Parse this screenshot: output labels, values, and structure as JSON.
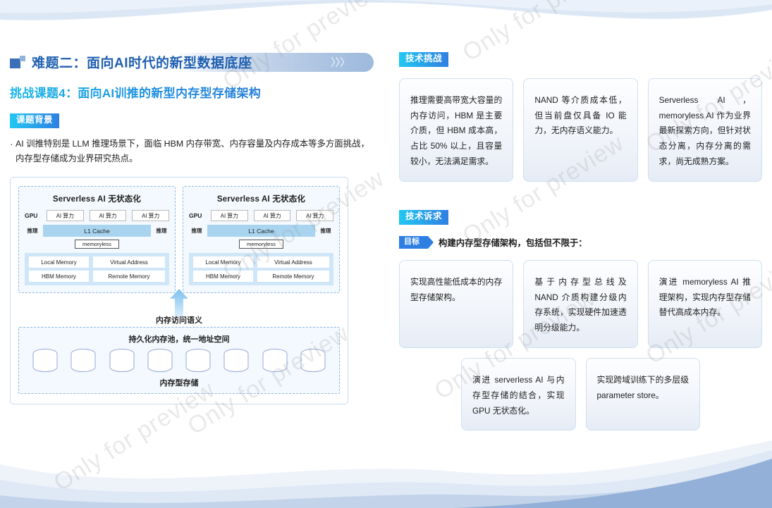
{
  "header": {
    "title": "难题二：面向AI时代的新型数据底座",
    "chevrons": "〉〉〉",
    "icon_big": "square-large",
    "icon_small": "square-small"
  },
  "subtitle": "挑战课题4：面向AI训推的新型内存型存储架构",
  "background": {
    "badge": "课题背景",
    "paragraph": "AI 训推特别是 LLM 推理场景下，面临 HBM 内存带宽、内存容量及内存成本等多方面挑战，内存型存储成为业界研究热点。"
  },
  "diagram": {
    "panels": [
      {
        "title": "Serverless AI 无状态化",
        "gpu_label": "GPU",
        "ai_cells": [
          "AI 算力",
          "AI 算力",
          "AI 算力"
        ],
        "infer_left": "推理",
        "infer_right": "推理",
        "cache": "L1 Cache",
        "memoryless": "memoryless",
        "mem_left": [
          "Local Memory",
          "HBM Memory"
        ],
        "mem_right": [
          "Virtual Address",
          "Remote Memory"
        ]
      },
      {
        "title": "Serverless AI 无状态化",
        "gpu_label": "GPU",
        "ai_cells": [
          "AI 算力",
          "AI 算力",
          "AI 算力"
        ],
        "infer_left": "推理",
        "infer_right": "推理",
        "cache": "L1 Cache",
        "memoryless": "memoryless",
        "mem_left": [
          "Local Memory",
          "HBM Memory"
        ],
        "mem_right": [
          "Virtual Address",
          "Remote Memory"
        ]
      }
    ],
    "arrow_label": "内存访问语义",
    "pool_title": "持久化内存池，统一地址空间",
    "pool_footer": "内存型存储",
    "cylinder_count": 8
  },
  "challenges": {
    "badge": "技术挑战",
    "cards": [
      "推理需要高带宽大容量的内存访问，HBM 是主要介质，但 HBM 成本高，占比 50% 以上，且容量较小，无法满足需求。",
      "NAND 等介质成本低，但当前盘仅具备 IO 能力，无内存语义能力。",
      "Serverless AI，memoryless AI 作为业界最新探索方向，但针对状态分离，内存分离的需求，尚无成熟方案。"
    ]
  },
  "requirements": {
    "badge": "技术诉求",
    "goal_badge": "目标",
    "goal_text": "构建内存型存储架构，包括但不限于：",
    "cards_row1": [
      "实现高性能低成本的内存型存储架构。",
      "基于内存型总线及 NAND 介质构建分级内存系统，实现硬件加速透明分级能力。",
      "演进 memoryless AI 推理架构，实现内存型存储替代高成本内存。"
    ],
    "cards_row2": [
      "演进 serverless AI 与内存型存储的结合，实现 GPU 无状态化。",
      "实现跨域训练下的多层级 parameter store。"
    ]
  },
  "watermark": {
    "text": "Only for preview"
  },
  "colors": {
    "accent_blue": "#2f7fe2",
    "accent_cyan": "#22c8f2",
    "title_blue": "#1f5fb0",
    "cache_fill": "#a9d4f0",
    "mem_fill": "#cfe6f8",
    "panel_bg": "#f3f9fe"
  }
}
